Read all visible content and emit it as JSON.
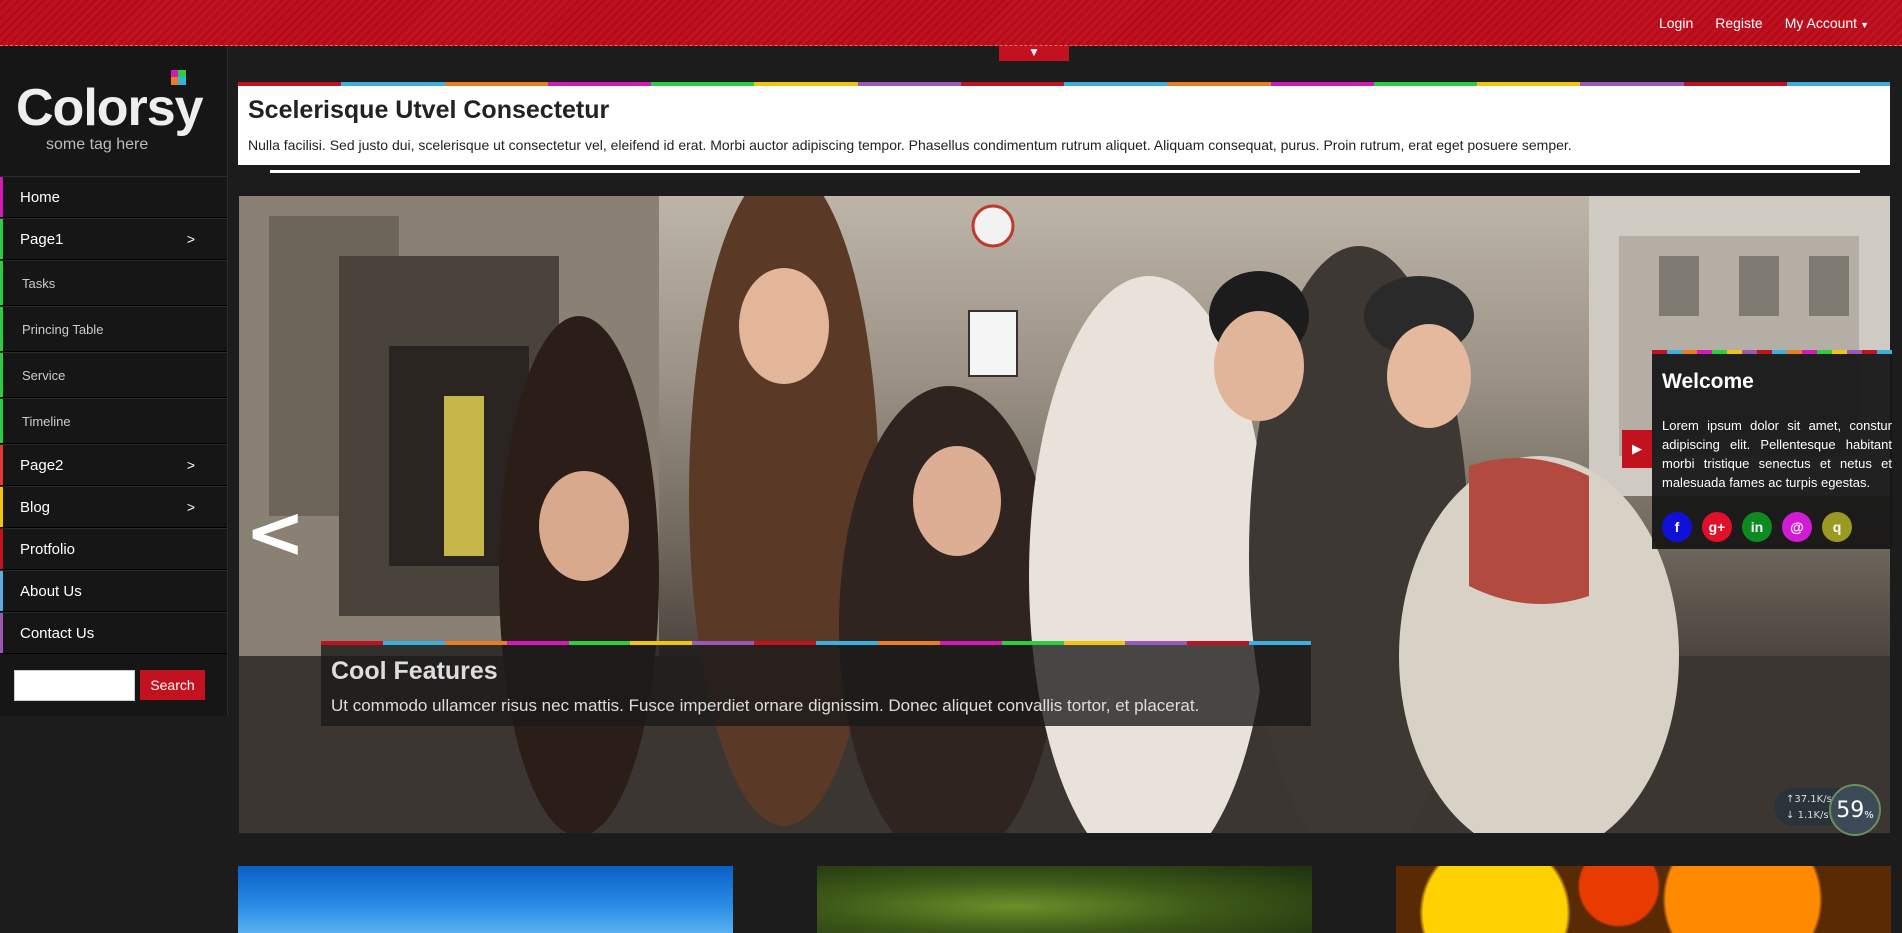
{
  "topnav": {
    "login": "Login",
    "register": "Registe",
    "account": "My Account"
  },
  "brand": {
    "name": "Colorsy",
    "tagline": "some tag here"
  },
  "sidebar": {
    "items": [
      {
        "label": "Home",
        "color": "#d21bb5",
        "arrow": ""
      },
      {
        "label": "Page1",
        "color": "#2ecc40",
        "arrow": ">"
      },
      {
        "label": "Tasks",
        "color": "#2ecc40",
        "arrow": ""
      },
      {
        "label": "Princing Table",
        "color": "#2ecc40",
        "arrow": ""
      },
      {
        "label": "Service",
        "color": "#2ecc40",
        "arrow": ""
      },
      {
        "label": "Timeline",
        "color": "#2ecc40",
        "arrow": ""
      },
      {
        "label": "Page2",
        "color": "#e53935",
        "arrow": ">"
      },
      {
        "label": "Blog",
        "color": "#f1c40f",
        "arrow": ">"
      },
      {
        "label": "Protfolio",
        "color": "#c2111f",
        "arrow": ""
      },
      {
        "label": "About Us",
        "color": "#5dade2",
        "arrow": ""
      },
      {
        "label": "Contact Us",
        "color": "#9b59b6",
        "arrow": ""
      }
    ],
    "search_button": "Search"
  },
  "header": {
    "title": "Scelerisque Utvel Consectetur",
    "text": "Nulla facilisi. Sed justo dui, scelerisque ut consectetur vel, eleifend id erat. Morbi auctor adipiscing tempor. Phasellus condimentum rutrum aliquet. Aliquam consequat, purus. Proin rutrum, erat eget posuere semper."
  },
  "slider": {
    "prev": "<",
    "caption_title": "Cool Features",
    "caption_text": "Ut commodo ullamcer risus nec mattis. Fusce imperdiet ornare dignissim. Donec aliquet convallis tortor, et placerat."
  },
  "welcome": {
    "title": "Welcome",
    "text": "Lorem ipsum dolor sit amet, constur adipiscing elit. Pellentesque habitant morbi tristique senectus et netus et malesuada fames ac turpis egestas.",
    "social": [
      {
        "label": "f",
        "color": "#1010d8",
        "icon": "facebook-icon"
      },
      {
        "label": "g+",
        "color": "#e0102a",
        "icon": "google-plus-icon"
      },
      {
        "label": "in",
        "color": "#0d8a22",
        "icon": "linkedin-icon"
      },
      {
        "label": "@",
        "color": "#d21bd5",
        "icon": "email-icon"
      },
      {
        "label": "q",
        "color": "#9a9a22",
        "icon": "q-icon"
      }
    ]
  },
  "speed": {
    "up": "37.1",
    "down": "1.1",
    "unit": "K/s",
    "percent": "59",
    "percent_sign": "%"
  },
  "stripe_colors": [
    "#c2111f",
    "#3ab0e0",
    "#e67e22",
    "#d21bb5",
    "#2ecc40",
    "#f1c40f",
    "#9b59b6",
    "#c2111f",
    "#3ab0e0",
    "#e67e22",
    "#d21bb5",
    "#2ecc40",
    "#f1c40f",
    "#9b59b6",
    "#c2111f",
    "#3ab0e0"
  ]
}
